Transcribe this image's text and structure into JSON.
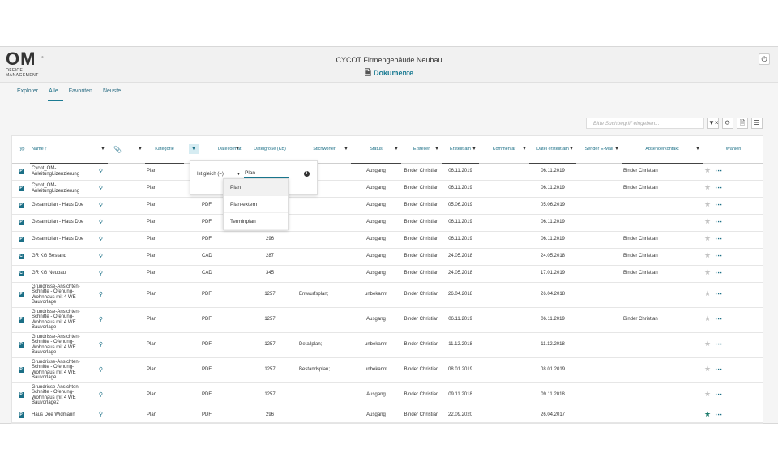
{
  "header": {
    "logo": {
      "mark": "OM",
      "line1": "OFFICE",
      "line2": "MANAGEMENT",
      "tm": "®"
    },
    "project_title": "CYCOT Firmengebäude Neubau",
    "page_title": "Dokumente",
    "page_icon": "document-icon",
    "power_icon": "power-icon"
  },
  "tabs": [
    {
      "label": "Explorer",
      "active": false
    },
    {
      "label": "Alle",
      "active": true
    },
    {
      "label": "Favoriten",
      "active": false
    },
    {
      "label": "Neuste",
      "active": false
    }
  ],
  "search": {
    "placeholder": "Bitte Suchbegriff eingeben..."
  },
  "toolbar_icons": [
    "clear-filter-icon",
    "refresh-icon",
    "new-document-icon",
    "columns-icon"
  ],
  "columns": {
    "typ": "Typ",
    "name": "Name",
    "attach": "attachment-icon",
    "kategorie": "Kategorie",
    "dateiformat": "Dateiformat",
    "dateigroesse": "Dateigröße (KB)",
    "stichwoerter": "Stichwörter",
    "status": "Status",
    "ersteller": "Ersteller",
    "erstellt_am": "Erstellt am",
    "kommentar": "Kommentar",
    "datei_erstellt_am": "Datei erstellt am",
    "sender_email": "Sender E-Mail",
    "absenderkontakt": "Absenderkontakt",
    "waehlen": "Wählen"
  },
  "filter": {
    "operator": "Ist gleich (=)",
    "value": "Plan",
    "suggestions": [
      "Plan",
      "Plan-extern",
      "Terminplan"
    ]
  },
  "rows": [
    {
      "type": "pdf",
      "name": "Cycot_OM-AnleitungLizenzierung",
      "kategorie": "Plan",
      "format": "",
      "size": "",
      "stichwoerter": "",
      "status": "Ausgang",
      "ersteller": "Binder Christian",
      "erstellt": "06.11.2019",
      "kommentar": "",
      "datei_erstellt": "06.11.2019",
      "sender": "",
      "absender": "Binder Christian",
      "fav": false
    },
    {
      "type": "pdf",
      "name": "Cycot_OM-AnleitungLizenzierung",
      "kategorie": "Plan",
      "format": "",
      "size": "",
      "stichwoerter": "",
      "status": "Ausgang",
      "ersteller": "Binder Christian",
      "erstellt": "06.11.2019",
      "kommentar": "",
      "datei_erstellt": "06.11.2019",
      "sender": "",
      "absender": "Binder Christian",
      "fav": false
    },
    {
      "type": "pdf",
      "name": "Gesamtplan - Haus Doe",
      "kategorie": "Plan",
      "format": "PDF",
      "size": "",
      "stichwoerter": "",
      "status": "Ausgang",
      "ersteller": "Binder Christian",
      "erstellt": "05.06.2019",
      "kommentar": "",
      "datei_erstellt": "05.06.2019",
      "sender": "",
      "absender": "",
      "fav": false
    },
    {
      "type": "pdf",
      "name": "Gesamtplan - Haus Doe",
      "kategorie": "Plan",
      "format": "PDF",
      "size": "",
      "stichwoerter": "",
      "status": "Ausgang",
      "ersteller": "Binder Christian",
      "erstellt": "06.11.2019",
      "kommentar": "",
      "datei_erstellt": "06.11.2019",
      "sender": "",
      "absender": "",
      "fav": false
    },
    {
      "type": "pdf",
      "name": "Gesamtplan - Haus Doe",
      "kategorie": "Plan",
      "format": "PDF",
      "size": "296",
      "stichwoerter": "",
      "status": "Ausgang",
      "ersteller": "Binder Christian",
      "erstellt": "06.11.2019",
      "kommentar": "",
      "datei_erstellt": "06.11.2019",
      "sender": "",
      "absender": "Binder Christian",
      "fav": false
    },
    {
      "type": "cad",
      "name": "GR KG Bestand",
      "kategorie": "Plan",
      "format": "CAD",
      "size": "287",
      "stichwoerter": "",
      "status": "Ausgang",
      "ersteller": "Binder Christian",
      "erstellt": "24.05.2018",
      "kommentar": "",
      "datei_erstellt": "24.05.2018",
      "sender": "",
      "absender": "Binder Christian",
      "fav": false
    },
    {
      "type": "cad",
      "name": "GR KG Neubau",
      "kategorie": "Plan",
      "format": "CAD",
      "size": "345",
      "stichwoerter": "",
      "status": "Ausgang",
      "ersteller": "Binder Christian",
      "erstellt": "24.05.2018",
      "kommentar": "",
      "datei_erstellt": "17.01.2019",
      "sender": "",
      "absender": "Binder Christian",
      "fav": false
    },
    {
      "type": "pdf",
      "name": "Grundrisse-Ansichten-Schnitte - Ofenung-Wohnhaus mit 4 WE Bauvorlage",
      "kategorie": "Plan",
      "format": "PDF",
      "size": "1257",
      "stichwoerter": "Entwurfsplan;",
      "status": "unbekannt",
      "ersteller": "Binder Christian",
      "erstellt": "26.04.2018",
      "kommentar": "",
      "datei_erstellt": "26.04.2018",
      "sender": "",
      "absender": "",
      "fav": false
    },
    {
      "type": "pdf",
      "name": "Grundrisse-Ansichten-Schnitte - Ofenung-Wohnhaus mit 4 WE Bauvorlage",
      "kategorie": "Plan",
      "format": "PDF",
      "size": "1257",
      "stichwoerter": "",
      "status": "Ausgang",
      "ersteller": "Binder Christian",
      "erstellt": "06.11.2019",
      "kommentar": "",
      "datei_erstellt": "06.11.2019",
      "sender": "",
      "absender": "Binder Christian",
      "fav": false
    },
    {
      "type": "pdf",
      "name": "Grundrisse-Ansichten-Schnitte - Ofenung-Wohnhaus mit 4 WE Bauvorlage",
      "kategorie": "Plan",
      "format": "PDF",
      "size": "1257",
      "stichwoerter": "Detailplan;",
      "status": "unbekannt",
      "ersteller": "Binder Christian",
      "erstellt": "11.12.2018",
      "kommentar": "",
      "datei_erstellt": "11.12.2018",
      "sender": "",
      "absender": "",
      "fav": false
    },
    {
      "type": "pdf",
      "name": "Grundrisse-Ansichten-Schnitte - Ofenung-Wohnhaus mit 4 WE Bauvorlage",
      "kategorie": "Plan",
      "format": "PDF",
      "size": "1257",
      "stichwoerter": "Bestandsplan;",
      "status": "unbekannt",
      "ersteller": "Binder Christian",
      "erstellt": "08.01.2019",
      "kommentar": "",
      "datei_erstellt": "08.01.2019",
      "sender": "",
      "absender": "",
      "fav": false
    },
    {
      "type": "pdf",
      "name": "Grundrisse-Ansichten-Schnitte - Ofenung-Wohnhaus mit 4 WE Bauvorlage2",
      "kategorie": "Plan",
      "format": "PDF",
      "size": "1257",
      "stichwoerter": "",
      "status": "Ausgang",
      "ersteller": "Binder Christian",
      "erstellt": "09.11.2018",
      "kommentar": "",
      "datei_erstellt": "09.11.2018",
      "sender": "",
      "absender": "",
      "fav": false
    },
    {
      "type": "pdf",
      "name": "Haus Doe Widmann",
      "kategorie": "Plan",
      "format": "PDF",
      "size": "296",
      "stichwoerter": "",
      "status": "Ausgang",
      "ersteller": "Binder Christian",
      "erstellt": "22.09.2020",
      "kommentar": "",
      "datei_erstellt": "26.04.2017",
      "sender": "",
      "absender": "",
      "fav": true
    }
  ],
  "row_heights": [],
  "colors": {
    "accent": "#1b7b93",
    "favorite": "#1b7b6b"
  }
}
